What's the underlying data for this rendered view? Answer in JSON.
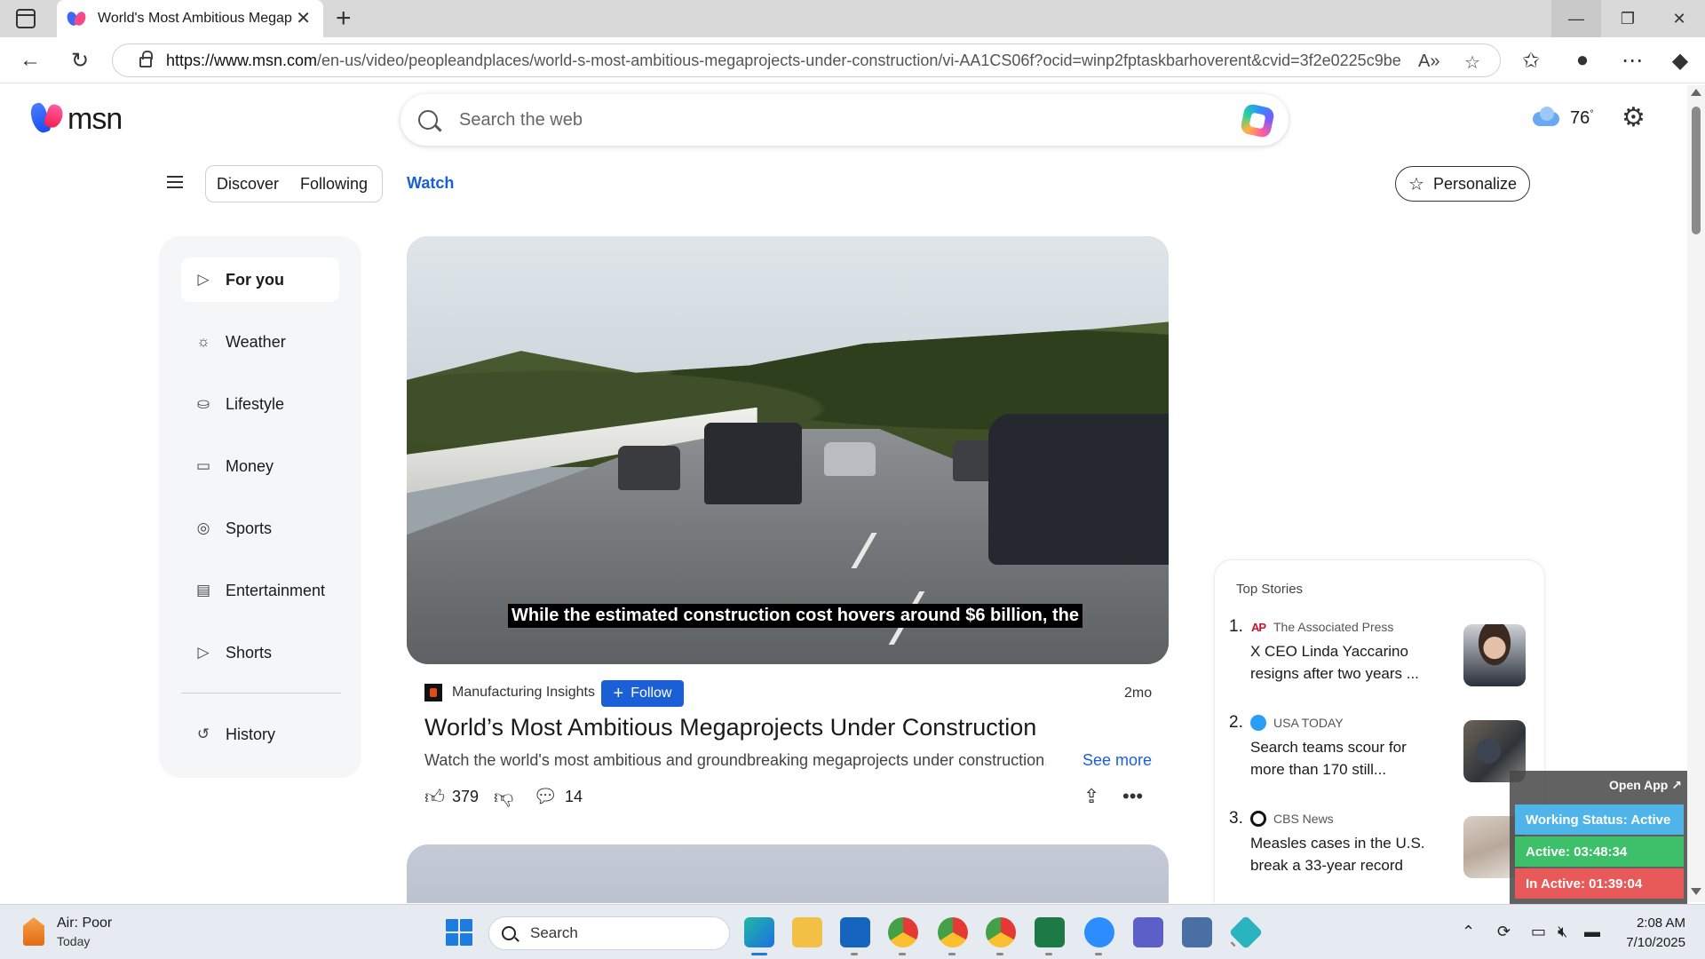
{
  "browser": {
    "tab_title": "World's Most Ambitious Megapr",
    "tab_close": "✕",
    "new_tab": "+",
    "url_host": "https://www.msn.com",
    "url_path": "/en-us/video/peopleandplaces/world-s-most-ambitious-megaprojects-under-construction/vi-AA1CS06f?ocid=winp2fptaskbarhoverent&cvid=3f2e0225c9be..."
  },
  "header": {
    "logo_text": "msn",
    "search_placeholder": "Search the web",
    "weather_temp": "76",
    "weather_unit": "°"
  },
  "subnav": {
    "discover": "Discover",
    "following": "Following",
    "watch": "Watch",
    "personalize": "Personalize"
  },
  "sidebar": {
    "items": [
      {
        "label": "For you",
        "icon": "play-icon"
      },
      {
        "label": "Weather",
        "icon": "weather-icon"
      },
      {
        "label": "Lifestyle",
        "icon": "lifestyle-icon"
      },
      {
        "label": "Money",
        "icon": "money-icon"
      },
      {
        "label": "Sports",
        "icon": "sports-icon"
      },
      {
        "label": "Entertainment",
        "icon": "entertainment-icon"
      },
      {
        "label": "Shorts",
        "icon": "shorts-icon"
      },
      {
        "label": "History",
        "icon": "history-icon"
      }
    ]
  },
  "video": {
    "caption": "While the estimated construction cost hovers around $6 billion, the",
    "source": "Manufacturing Insights",
    "follow_label": "Follow",
    "age": "2mo",
    "title": "World’s Most Ambitious Megaprojects Under Construction",
    "description": "Watch the world's most ambitious and groundbreaking megaprojects under construction...",
    "see_more": "See more",
    "likes": "379",
    "comments": "14"
  },
  "top_stories": {
    "heading": "Top Stories",
    "items": [
      {
        "num": "1.",
        "source": "The Associated Press",
        "badge": "AP",
        "title": "X CEO Linda Yaccarino resigns after two years ..."
      },
      {
        "num": "2.",
        "source": "USA TODAY",
        "badge": "",
        "title": "Search teams scour for more than 170 still..."
      },
      {
        "num": "3.",
        "source": "CBS News",
        "badge": "",
        "title": "Measles cases in the U.S. break a 33-year record"
      }
    ]
  },
  "overlay": {
    "open_app": "Open App ↗",
    "working_status": "Working Status: Active",
    "active": "Active: 03:48:34",
    "inactive": "In Active: 01:39:04"
  },
  "taskbar": {
    "aq_title": "Air: Poor",
    "aq_sub": "Today",
    "search_label": "Search",
    "time": "2:08 AM",
    "date": "7/10/2025"
  },
  "colors": {
    "accent": "#1a5fd6",
    "working": "#4fb4e8",
    "active": "#3ec06a",
    "inactive": "#e85a5a"
  }
}
